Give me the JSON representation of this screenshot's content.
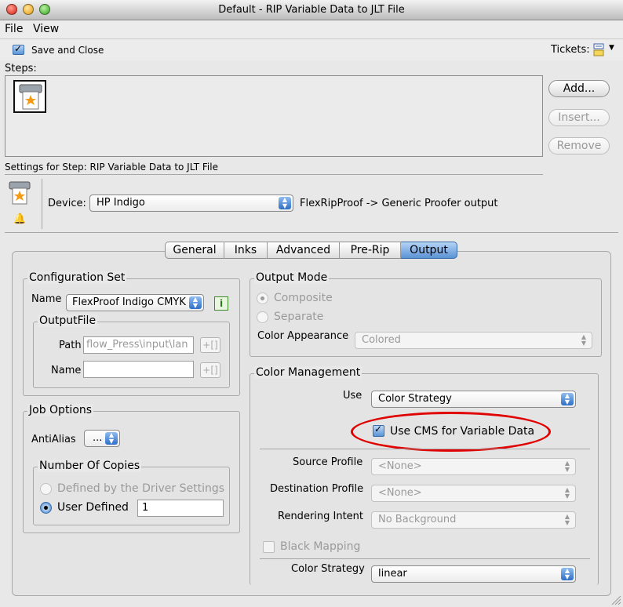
{
  "window": {
    "title": "Default - RIP Variable Data to JLT File"
  },
  "menu": {
    "file": "File",
    "view": "View"
  },
  "toolbar": {
    "save_close": "Save and Close",
    "tickets": "Tickets:"
  },
  "steps": {
    "label": "Steps:",
    "add": "Add...",
    "insert": "Insert...",
    "remove": "Remove"
  },
  "settings": {
    "title": "Settings for Step: RIP Variable Data to JLT File",
    "device_label": "Device:",
    "device_value": "HP Indigo",
    "device_info": "FlexRipProof -> Generic Proofer output"
  },
  "tabs": [
    "General",
    "Inks",
    "Advanced",
    "Pre-Rip",
    "Output"
  ],
  "active_tab": "Output",
  "config": {
    "title": "Configuration Set",
    "name_label": "Name",
    "name_value": "FlexProof Indigo CMYK",
    "info_icon": "i",
    "outputfile_title": "OutputFile",
    "path_label": "Path",
    "path_value": "flow_Press\\input\\lan",
    "name2_label": "Name",
    "name2_value": "",
    "insert_btn": "+[]"
  },
  "job": {
    "title": "Job Options",
    "antialias_label": "AntiAlias",
    "antialias_value": "...",
    "copies_title": "Number Of Copies",
    "driver": "Defined by the Driver Settings",
    "user": "User Defined",
    "user_value": "1"
  },
  "output_mode": {
    "title": "Output Mode",
    "composite": "Composite",
    "separate": "Separate",
    "appearance_label": "Color Appearance",
    "appearance_value": "Colored"
  },
  "color_mgmt": {
    "title": "Color Management",
    "use_label": "Use",
    "use_value": "Color Strategy",
    "cms": "Use CMS for Variable Data",
    "source_label": "Source Profile",
    "source_value": "<None>",
    "dest_label": "Destination Profile",
    "dest_value": "<None>",
    "intent_label": "Rendering Intent",
    "intent_value": "No Background",
    "black_mapping": "Black Mapping",
    "strategy_label": "Color Strategy",
    "strategy_value": "linear"
  },
  "colors": {
    "highlight_ellipse": "#e00000",
    "accent": "#5b93d6"
  }
}
